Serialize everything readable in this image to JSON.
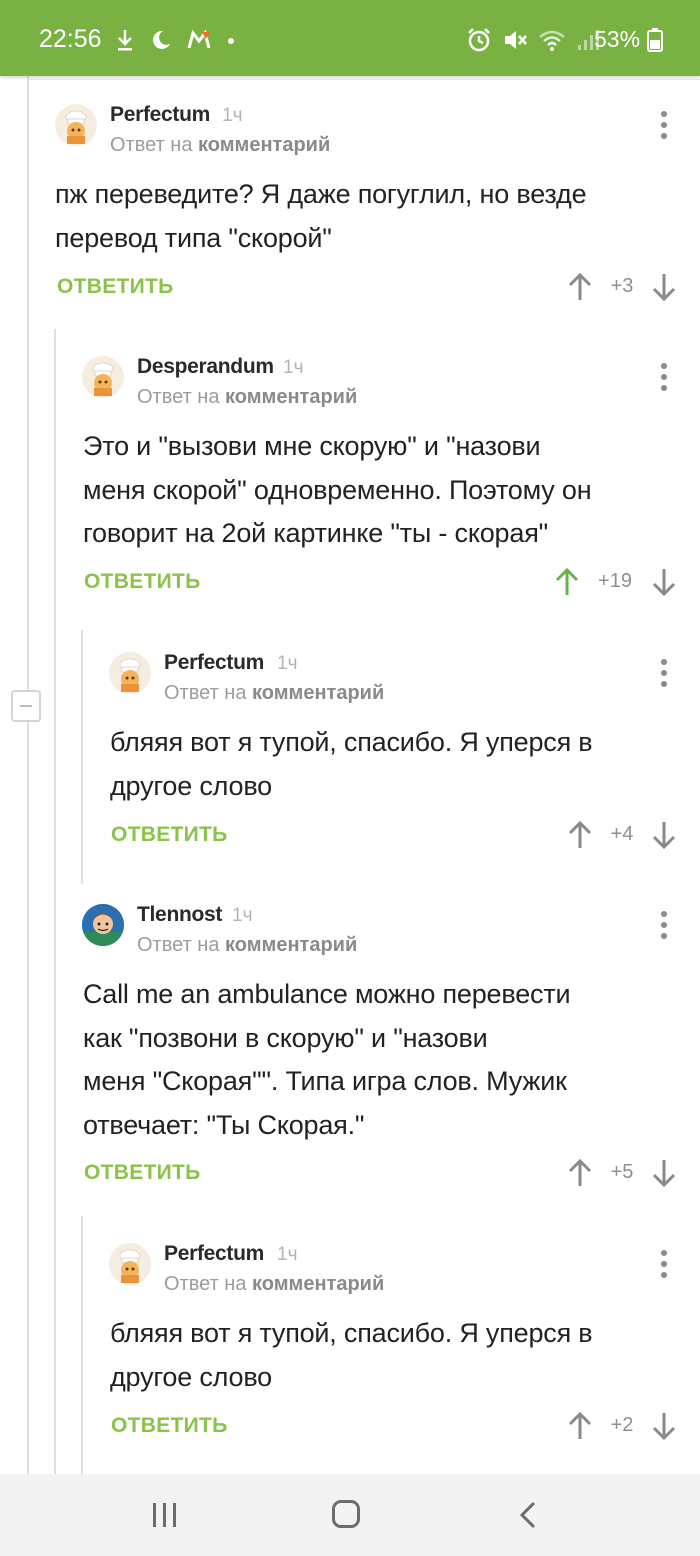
{
  "status_bar": {
    "time": "22:56",
    "battery": "53%",
    "left_icons": [
      "download-icon",
      "moon-icon",
      "app-notification-icon",
      "dot-icon"
    ],
    "right_icons": [
      "alarm-icon",
      "mute-icon",
      "wifi-icon",
      "signal-icon",
      "battery-icon"
    ]
  },
  "comments": [
    {
      "author": "Perfectum",
      "time": "1ч",
      "reply_prefix": "Ответ на",
      "reply_link": "комментарий",
      "lines": [
        "пж переведите? Я даже погуглил, но везде",
        "перевод типа \"скорой\""
      ],
      "reply_label": "ОТВЕТИТЬ",
      "rating": "+3",
      "upvoted": false,
      "avatar": "chef-avatar"
    },
    {
      "author": "Desperandum",
      "time": "1ч",
      "reply_prefix": "Ответ на",
      "reply_link": "комментарий",
      "lines": [
        "Это и \"вызови мне скорую\" и \"назови",
        "меня скорой\" одновременно. Поэтому он",
        "говорит на 2ой картинке \"ты - скорая\""
      ],
      "reply_label": "ОТВЕТИТЬ",
      "rating": "+19",
      "upvoted": true,
      "avatar": "chef-avatar"
    },
    {
      "author": "Perfectum",
      "time": "1ч",
      "reply_prefix": "Ответ на",
      "reply_link": "комментарий",
      "lines": [
        "бляяя вот я тупой, спасибо. Я уперся в",
        "другое слово"
      ],
      "reply_label": "ОТВЕТИТЬ",
      "rating": "+4",
      "upvoted": false,
      "avatar": "chef-avatar"
    },
    {
      "author": "Tlennost",
      "time": "1ч",
      "reply_prefix": "Ответ на",
      "reply_link": "комментарий",
      "lines": [
        "Call me an ambulance можно перевести",
        "как \"позвони в скорую\" и \"назови",
        "меня \"Скорая\"\". Типа игра слов. Мужик",
        "отвечает: \"Ты Скорая.\""
      ],
      "reply_label": "ОТВЕТИТЬ",
      "rating": "+5",
      "upvoted": false,
      "avatar": "user-avatar"
    },
    {
      "author": "Perfectum",
      "time": "1ч",
      "reply_prefix": "Ответ на",
      "reply_link": "комментарий",
      "lines": [
        "бляяя вот я тупой, спасибо. Я уперся в",
        "другое слово"
      ],
      "reply_label": "ОТВЕТИТЬ",
      "rating": "+2",
      "upvoted": false,
      "avatar": "chef-avatar"
    }
  ],
  "colors": {
    "accent": "#79b243",
    "reply_green": "#8bc34a",
    "upvote_active": "#6ab04c",
    "vote_gray": "#8a8a8a"
  },
  "nav_bar": {
    "buttons": [
      "recents-icon",
      "home-icon",
      "back-icon"
    ]
  }
}
